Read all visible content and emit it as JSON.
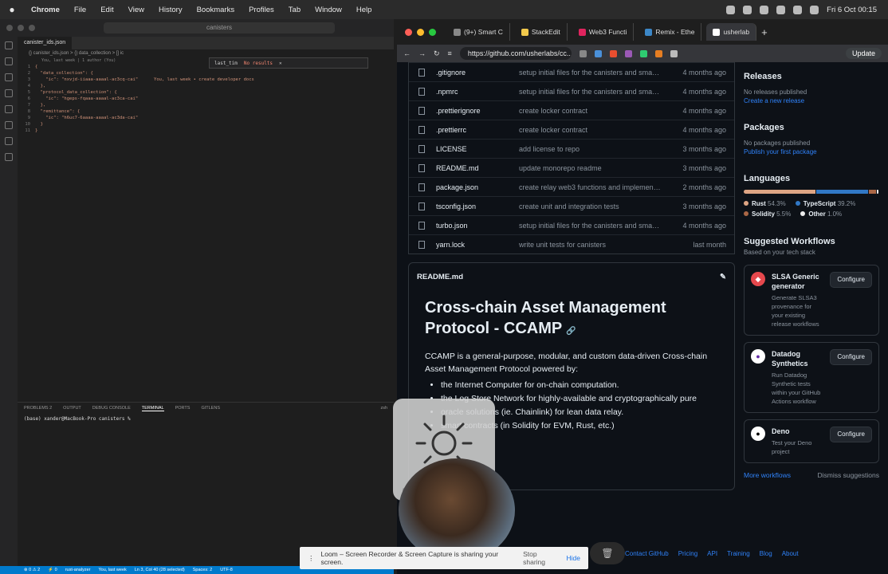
{
  "menubar": {
    "app": "Chrome",
    "items": [
      "File",
      "Edit",
      "View",
      "History",
      "Bookmarks",
      "Profiles",
      "Tab",
      "Window",
      "Help"
    ],
    "clock": "Fri 6 Oct  00:15"
  },
  "vscode": {
    "search": "canisters",
    "tab": "canister_ids.json",
    "breadcrumb": "{} canister_ids.json > {} data_collection > [] ic",
    "blame": "You, last week | 1 author (You)",
    "find_value": "last_tim",
    "find_result": "No results",
    "code_lines": [
      {
        "n": "1",
        "text": "{"
      },
      {
        "n": "2",
        "text": "  \"data_collection\": {"
      },
      {
        "n": "3",
        "text": "    \"ic\": \"nxvjd-iiaaa-aaaal-ac3cq-cai\"      You, last week • create developer docs"
      },
      {
        "n": "4",
        "text": "  },"
      },
      {
        "n": "5",
        "text": "  \"protocol_data_collection\": {"
      },
      {
        "n": "6",
        "text": "    \"ic\": \"hgeps-fqaaa-aaaal-ac3ca-cai\""
      },
      {
        "n": "7",
        "text": "  },"
      },
      {
        "n": "8",
        "text": "  \"remittance\": {"
      },
      {
        "n": "9",
        "text": "    \"ic\": \"h6uc7-6aaaa-aaaal-ac3da-cai\""
      },
      {
        "n": "10",
        "text": "  }"
      },
      {
        "n": "11",
        "text": "}"
      }
    ],
    "panel_tabs": [
      "PROBLEMS",
      "OUTPUT",
      "DEBUG CONSOLE",
      "TERMINAL",
      "PORTS",
      "GITLENS"
    ],
    "problems_count": "2",
    "terminal_shell": "zsh",
    "terminal_line": "(base) xander@MacBook-Pro canisters % ",
    "status": [
      "⊗ 0 ⚠ 2",
      "⚡ 0",
      "rust-analyzer",
      "You, last week",
      "Ln 3, Col 40 (28 selected)",
      "Spaces: 2",
      "UTF-8"
    ]
  },
  "browser": {
    "tabs": [
      "(9+) Smart C",
      "StackEdit",
      "Web3 Functi",
      "Remix - Ethe",
      "usherlab"
    ],
    "url": "https://github.com/usherlabs/cc...",
    "update_label": "Update",
    "files": [
      {
        "name": ".gitignore",
        "msg": "setup initial files for the canisters and smart...",
        "time": "4 months ago"
      },
      {
        "name": ".npmrc",
        "msg": "setup initial files for the canisters and smart...",
        "time": "4 months ago"
      },
      {
        "name": ".prettierignore",
        "msg": "create locker contract",
        "time": "4 months ago"
      },
      {
        "name": ".prettierrc",
        "msg": "create locker contract",
        "time": "4 months ago"
      },
      {
        "name": "LICENSE",
        "msg": "add license to repo",
        "time": "3 months ago"
      },
      {
        "name": "README.md",
        "msg": "update monorepo readme",
        "time": "3 months ago"
      },
      {
        "name": "package.json",
        "msg": "create relay web3 functions and implement ...",
        "time": "2 months ago"
      },
      {
        "name": "tsconfig.json",
        "msg": "create unit and integration tests",
        "time": "3 months ago"
      },
      {
        "name": "turbo.json",
        "msg": "setup initial files for the canisters and smart...",
        "time": "4 months ago"
      },
      {
        "name": "yarn.lock",
        "msg": "write unit tests for canisters",
        "time": "last month"
      }
    ],
    "readme": {
      "header": "README.md",
      "title": "Cross-chain Asset Management Protocol - CCAMP",
      "intro": "CCAMP is a general-purpose, modular, and custom data-driven Cross-chain Asset Management Protocol powered by:",
      "bullets": [
        "the Internet Computer for on-chain computation.",
        "the Log Store Network for highly-available and cryptographically pure",
        "oracle solutions (ie. Chainlink) for lean data relay.",
        "smart contracts (in Solidity for EVM, Rust, etc.)"
      ]
    },
    "sidebar": {
      "releases_title": "Releases",
      "releases_text": "No releases published",
      "releases_link": "Create a new release",
      "packages_title": "Packages",
      "packages_text": "No packages published",
      "packages_link": "Publish your first package",
      "languages_title": "Languages",
      "languages": [
        {
          "name": "Rust",
          "pct": "54.3%",
          "value": 54.3,
          "color": "#dea584"
        },
        {
          "name": "TypeScript",
          "pct": "39.2%",
          "value": 39.2,
          "color": "#3178c6"
        },
        {
          "name": "Solidity",
          "pct": "5.5%",
          "value": 5.5,
          "color": "#aa6746"
        },
        {
          "name": "Other",
          "pct": "1.0%",
          "value": 1.0,
          "color": "#ededed"
        }
      ],
      "workflows_title": "Suggested Workflows",
      "workflows_sub": "Based on your tech stack",
      "workflows": [
        {
          "title": "SLSA Generic generator",
          "desc": "Generate SLSA3 provenance for your existing release workflows",
          "button": "Configure",
          "icon": "slsa-icon"
        },
        {
          "title": "Datadog Synthetics",
          "desc": "Run Datadog Synthetic tests within your GitHub Actions workflow",
          "button": "Configure",
          "icon": "datadog-icon"
        },
        {
          "title": "Deno",
          "desc": "Test your Deno project",
          "button": "Configure",
          "icon": "deno-icon"
        }
      ],
      "more_workflows": "More workflows",
      "dismiss": "Dismiss suggestions"
    },
    "footer_links": [
      "Contact GitHub",
      "Pricing",
      "API",
      "Training",
      "Blog",
      "About"
    ]
  },
  "overlays": {
    "brightness_level": 0.0,
    "loom_text": "Loom – Screen Recorder & Screen Capture is sharing your screen.",
    "stop_sharing": "Stop sharing",
    "hide": "Hide"
  }
}
